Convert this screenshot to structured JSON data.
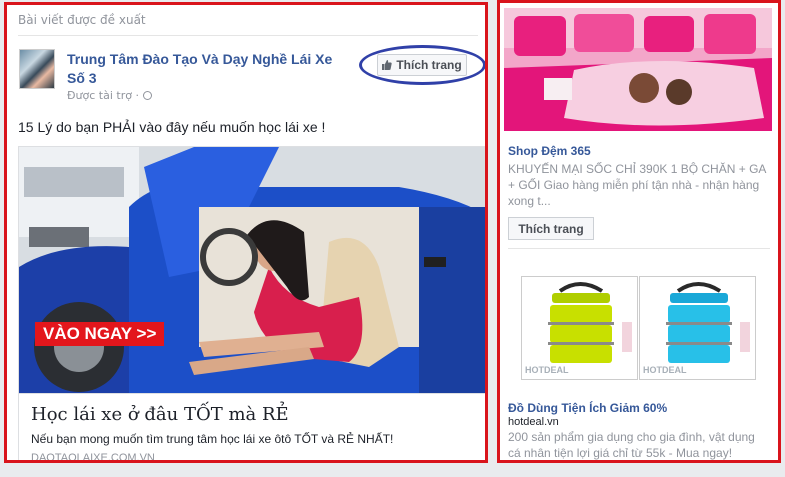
{
  "left_panel": {
    "section_title": "Bài viết được đề xuất",
    "page_name": "Trung Tâm Đào Tạo Và Dạy Nghề Lái Xe Số 3",
    "sponsored_label": "Được tài trợ ·",
    "like_button_label": "Thích trang",
    "post_text": "15 Lý do bạn PHẢI vào đây nếu muốn học lái xe !",
    "ad_cta_banner": "VÀO NGAY >>",
    "ad_headline": "Học lái xe ở đâu TỐT mà RẺ",
    "ad_description": "Nếu bạn mong muốn tìm trung tâm học lái xe ôtô TỐT và RẺ NHẤT!",
    "ad_domain": "DAOTAOLAIXE.COM.VN"
  },
  "right_panel": {
    "ad1": {
      "title": "Shop Đệm 365",
      "description": "KHUYẾN MẠI SỐC CHỈ 390K 1 BỘ CHĂN + GA + GỐI Giao hàng miễn phí tận nhà - nhận hàng xong t...",
      "like_button_label": "Thích trang"
    },
    "ad2": {
      "title": "Đồ Dùng Tiện Ích Giảm 60%",
      "domain": "hotdeal.vn",
      "description": "200 sản phẩm gia dụng cho gia đình, vật dụng cá nhân tiện lợi giá chỉ từ 55k - Mua ngay!",
      "watermark_left": "HOTDEAL",
      "watermark_right": "HOTDEAL"
    }
  },
  "colors": {
    "highlight_border": "#d9141c",
    "circle_annotation": "#3040a8",
    "link_blue": "#365899",
    "banner_red": "#e3161c",
    "car_blue": "#1c4fc8",
    "lunchbox_lime": "#c8e000",
    "lunchbox_cyan": "#28c0e8"
  },
  "icons": {
    "like": "thumbs-up-icon",
    "sponsored": "globe-icon"
  }
}
